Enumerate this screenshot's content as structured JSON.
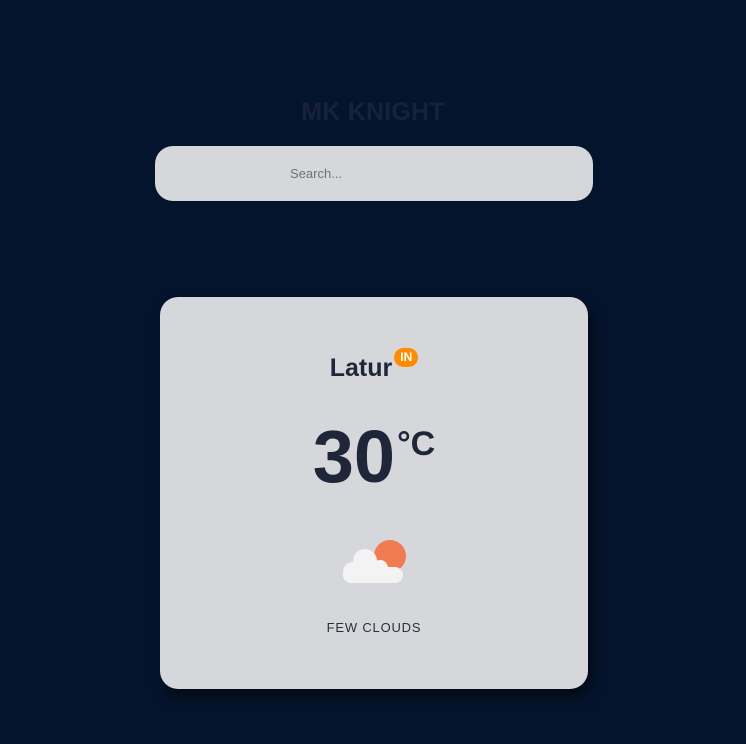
{
  "brand": {
    "title": "MK KNIGHT"
  },
  "search": {
    "placeholder": "Search..."
  },
  "weather": {
    "city": "Latur",
    "country_code": "IN",
    "temperature": "30",
    "unit": "°C",
    "condition": "FEW CLOUDS",
    "icon": "few-clouds-day-icon"
  },
  "colors": {
    "page_background": "#05142d",
    "card_background": "#d6d7db",
    "badge_background": "#ff8c00",
    "sun": "#f07a52",
    "cloud": "#f3f3f3",
    "text_dark": "#1f2638"
  }
}
